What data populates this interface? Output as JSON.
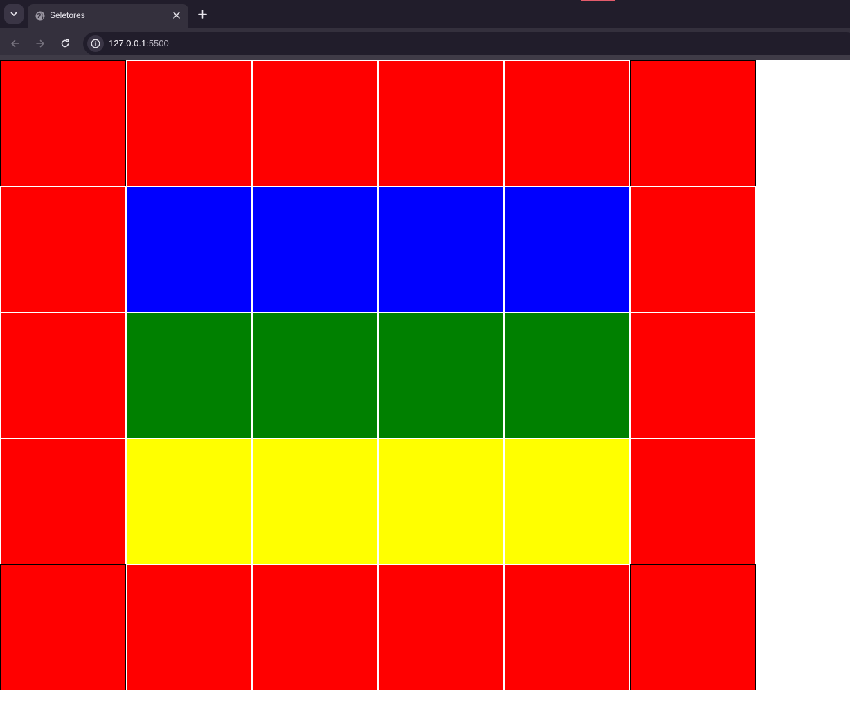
{
  "browser": {
    "tab": {
      "title": "Seletores",
      "favicon": "globe-icon",
      "close_icon": "close-icon"
    },
    "tab_list_icon": "chevron-down-icon",
    "new_tab_icon": "plus-icon",
    "nav": {
      "back_icon": "arrow-left-icon",
      "forward_icon": "arrow-right-icon",
      "reload_icon": "reload-icon",
      "site_info_icon": "info-icon"
    },
    "address": {
      "host": "127.0.0.1",
      "port": ":5500"
    }
  },
  "page": {
    "colors": {
      "red": "#ff0000",
      "blue": "#0000ff",
      "green": "#008000",
      "yellow": "#ffff00"
    },
    "rows": [
      [
        "red",
        "red",
        "red",
        "red",
        "red",
        "red"
      ],
      [
        "red",
        "blue",
        "blue",
        "blue",
        "blue",
        "red"
      ],
      [
        "red",
        "green",
        "green",
        "green",
        "green",
        "red"
      ],
      [
        "red",
        "yellow",
        "yellow",
        "yellow",
        "yellow",
        "red"
      ],
      [
        "red",
        "red",
        "red",
        "red",
        "red",
        "red"
      ]
    ]
  }
}
